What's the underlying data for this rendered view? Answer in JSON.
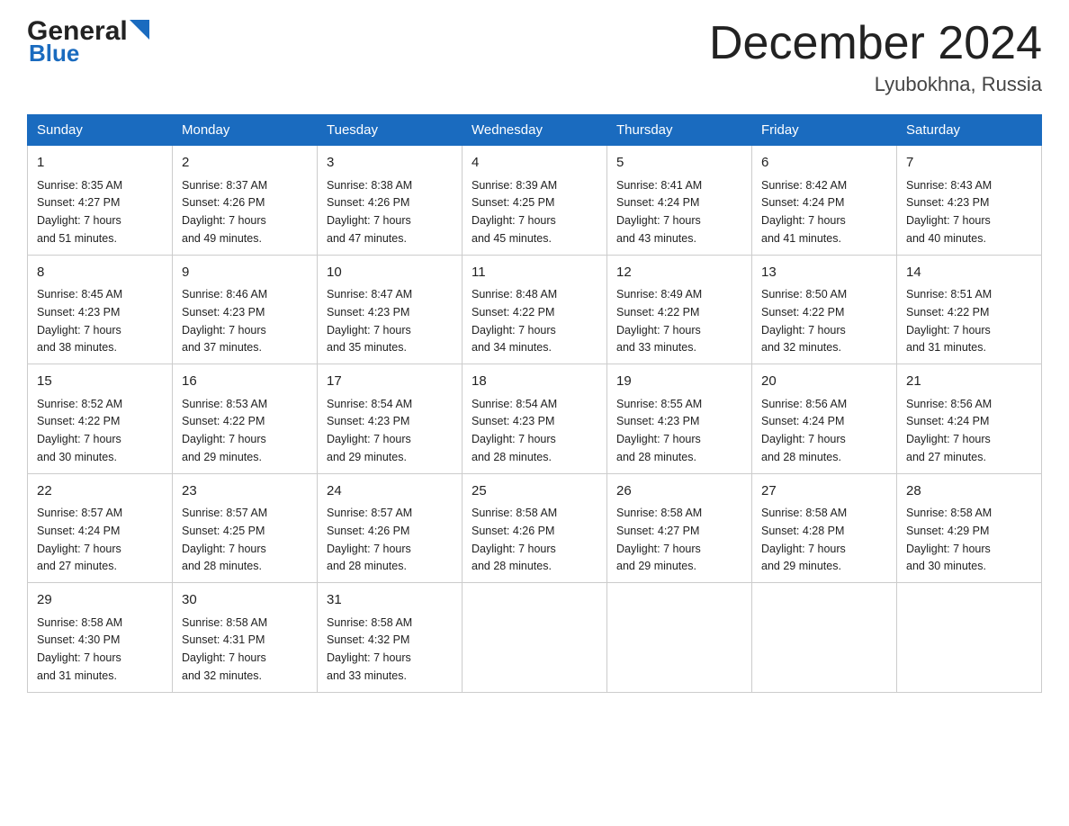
{
  "logo": {
    "text_general": "General",
    "text_blue": "Blue"
  },
  "title": "December 2024",
  "subtitle": "Lyubokhna, Russia",
  "days_of_week": [
    "Sunday",
    "Monday",
    "Tuesday",
    "Wednesday",
    "Thursday",
    "Friday",
    "Saturday"
  ],
  "weeks": [
    [
      {
        "day": "1",
        "info": "Sunrise: 8:35 AM\nSunset: 4:27 PM\nDaylight: 7 hours\nand 51 minutes."
      },
      {
        "day": "2",
        "info": "Sunrise: 8:37 AM\nSunset: 4:26 PM\nDaylight: 7 hours\nand 49 minutes."
      },
      {
        "day": "3",
        "info": "Sunrise: 8:38 AM\nSunset: 4:26 PM\nDaylight: 7 hours\nand 47 minutes."
      },
      {
        "day": "4",
        "info": "Sunrise: 8:39 AM\nSunset: 4:25 PM\nDaylight: 7 hours\nand 45 minutes."
      },
      {
        "day": "5",
        "info": "Sunrise: 8:41 AM\nSunset: 4:24 PM\nDaylight: 7 hours\nand 43 minutes."
      },
      {
        "day": "6",
        "info": "Sunrise: 8:42 AM\nSunset: 4:24 PM\nDaylight: 7 hours\nand 41 minutes."
      },
      {
        "day": "7",
        "info": "Sunrise: 8:43 AM\nSunset: 4:23 PM\nDaylight: 7 hours\nand 40 minutes."
      }
    ],
    [
      {
        "day": "8",
        "info": "Sunrise: 8:45 AM\nSunset: 4:23 PM\nDaylight: 7 hours\nand 38 minutes."
      },
      {
        "day": "9",
        "info": "Sunrise: 8:46 AM\nSunset: 4:23 PM\nDaylight: 7 hours\nand 37 minutes."
      },
      {
        "day": "10",
        "info": "Sunrise: 8:47 AM\nSunset: 4:23 PM\nDaylight: 7 hours\nand 35 minutes."
      },
      {
        "day": "11",
        "info": "Sunrise: 8:48 AM\nSunset: 4:22 PM\nDaylight: 7 hours\nand 34 minutes."
      },
      {
        "day": "12",
        "info": "Sunrise: 8:49 AM\nSunset: 4:22 PM\nDaylight: 7 hours\nand 33 minutes."
      },
      {
        "day": "13",
        "info": "Sunrise: 8:50 AM\nSunset: 4:22 PM\nDaylight: 7 hours\nand 32 minutes."
      },
      {
        "day": "14",
        "info": "Sunrise: 8:51 AM\nSunset: 4:22 PM\nDaylight: 7 hours\nand 31 minutes."
      }
    ],
    [
      {
        "day": "15",
        "info": "Sunrise: 8:52 AM\nSunset: 4:22 PM\nDaylight: 7 hours\nand 30 minutes."
      },
      {
        "day": "16",
        "info": "Sunrise: 8:53 AM\nSunset: 4:22 PM\nDaylight: 7 hours\nand 29 minutes."
      },
      {
        "day": "17",
        "info": "Sunrise: 8:54 AM\nSunset: 4:23 PM\nDaylight: 7 hours\nand 29 minutes."
      },
      {
        "day": "18",
        "info": "Sunrise: 8:54 AM\nSunset: 4:23 PM\nDaylight: 7 hours\nand 28 minutes."
      },
      {
        "day": "19",
        "info": "Sunrise: 8:55 AM\nSunset: 4:23 PM\nDaylight: 7 hours\nand 28 minutes."
      },
      {
        "day": "20",
        "info": "Sunrise: 8:56 AM\nSunset: 4:24 PM\nDaylight: 7 hours\nand 28 minutes."
      },
      {
        "day": "21",
        "info": "Sunrise: 8:56 AM\nSunset: 4:24 PM\nDaylight: 7 hours\nand 27 minutes."
      }
    ],
    [
      {
        "day": "22",
        "info": "Sunrise: 8:57 AM\nSunset: 4:24 PM\nDaylight: 7 hours\nand 27 minutes."
      },
      {
        "day": "23",
        "info": "Sunrise: 8:57 AM\nSunset: 4:25 PM\nDaylight: 7 hours\nand 28 minutes."
      },
      {
        "day": "24",
        "info": "Sunrise: 8:57 AM\nSunset: 4:26 PM\nDaylight: 7 hours\nand 28 minutes."
      },
      {
        "day": "25",
        "info": "Sunrise: 8:58 AM\nSunset: 4:26 PM\nDaylight: 7 hours\nand 28 minutes."
      },
      {
        "day": "26",
        "info": "Sunrise: 8:58 AM\nSunset: 4:27 PM\nDaylight: 7 hours\nand 29 minutes."
      },
      {
        "day": "27",
        "info": "Sunrise: 8:58 AM\nSunset: 4:28 PM\nDaylight: 7 hours\nand 29 minutes."
      },
      {
        "day": "28",
        "info": "Sunrise: 8:58 AM\nSunset: 4:29 PM\nDaylight: 7 hours\nand 30 minutes."
      }
    ],
    [
      {
        "day": "29",
        "info": "Sunrise: 8:58 AM\nSunset: 4:30 PM\nDaylight: 7 hours\nand 31 minutes."
      },
      {
        "day": "30",
        "info": "Sunrise: 8:58 AM\nSunset: 4:31 PM\nDaylight: 7 hours\nand 32 minutes."
      },
      {
        "day": "31",
        "info": "Sunrise: 8:58 AM\nSunset: 4:32 PM\nDaylight: 7 hours\nand 33 minutes."
      },
      {
        "day": "",
        "info": ""
      },
      {
        "day": "",
        "info": ""
      },
      {
        "day": "",
        "info": ""
      },
      {
        "day": "",
        "info": ""
      }
    ]
  ]
}
